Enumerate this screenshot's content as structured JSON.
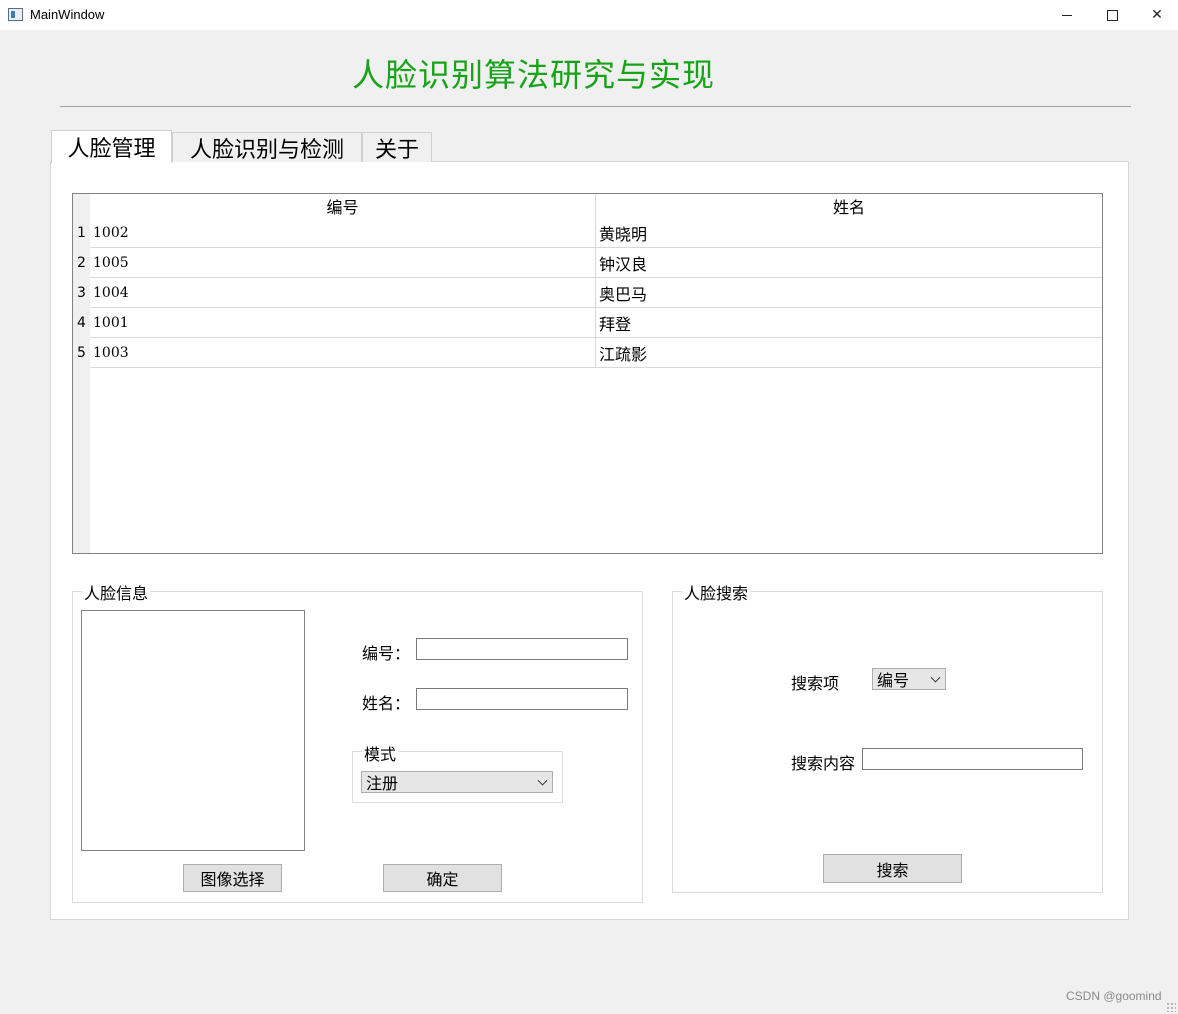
{
  "window": {
    "title": "MainWindow",
    "controls": {
      "minimize": "minimize-icon",
      "maximize": "maximize-icon",
      "close": "✕"
    }
  },
  "header": {
    "title": "人脸识别算法研究与实现",
    "title_color": "#17a317"
  },
  "tabs": [
    {
      "label": "人脸管理",
      "active": true
    },
    {
      "label": "人脸识别与检测",
      "active": false
    },
    {
      "label": "关于",
      "active": false
    }
  ],
  "table": {
    "columns": [
      "编号",
      "姓名"
    ],
    "rows": [
      {
        "num": "1",
        "id": "1002",
        "name": "黄晓明"
      },
      {
        "num": "2",
        "id": "1005",
        "name": "钟汉良"
      },
      {
        "num": "3",
        "id": "1004",
        "name": "奥巴马"
      },
      {
        "num": "4",
        "id": "1001",
        "name": "拜登"
      },
      {
        "num": "5",
        "id": "1003",
        "name": "江疏影"
      }
    ]
  },
  "face_info": {
    "title": "人脸信息",
    "id_label": "编号：",
    "id_value": "",
    "name_label": "姓名：",
    "name_value": "",
    "mode_title": "模式",
    "mode_selected": "注册",
    "image_select_button": "图像选择",
    "confirm_button": "确定"
  },
  "face_search": {
    "title": "人脸搜索",
    "field_label": "搜索项",
    "field_selected": "编号",
    "content_label": "搜索内容",
    "content_value": "",
    "search_button": "搜索"
  },
  "watermark": "CSDN @goomind"
}
